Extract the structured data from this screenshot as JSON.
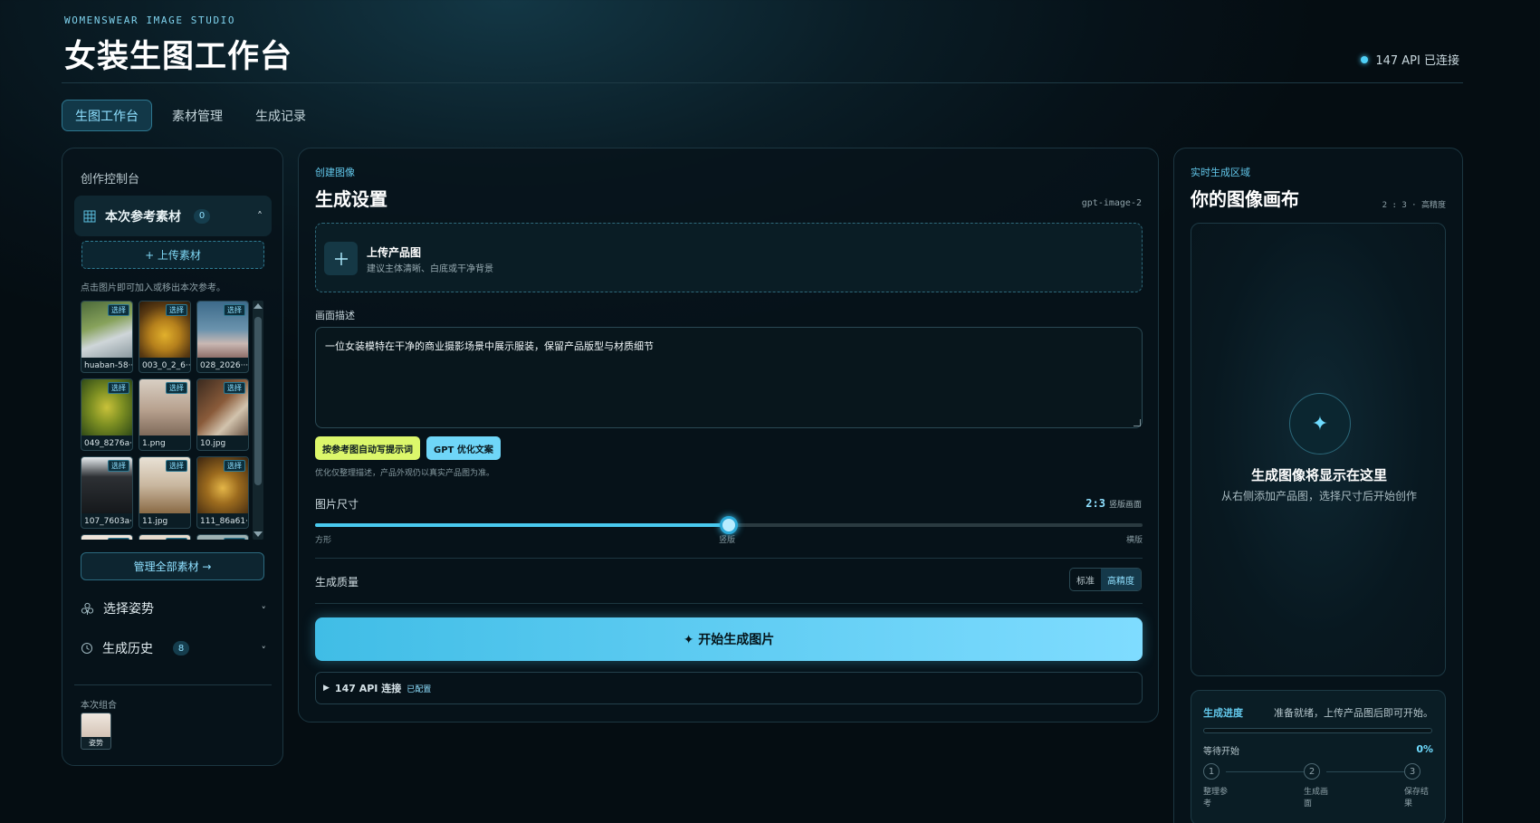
{
  "header": {
    "brand_sub": "WOMENSWEAR IMAGE STUDIO",
    "title": "女装生图工作台",
    "api_status": "147 API 已连接"
  },
  "colors": {
    "accent": "#4fd0f7",
    "lime": "#dcf76b",
    "bg": "#061219"
  },
  "tabs": [
    {
      "label": "生图工作台",
      "active": true
    },
    {
      "label": "素材管理",
      "active": false
    },
    {
      "label": "生成记录",
      "active": false
    }
  ],
  "left": {
    "title": "创作控制台",
    "ref_section": {
      "label": "本次参考素材",
      "count": "0",
      "caret": "˄",
      "icon": "grid-icon"
    },
    "upload_label": "+ 上传素材",
    "hint": "点击图片即可加入或移出本次参考。",
    "select_label": "选择",
    "thumbnails": [
      {
        "name": "huaban-58···"
      },
      {
        "name": "003_0_2_6···"
      },
      {
        "name": "028_2026···"
      },
      {
        "name": "049_8276a···"
      },
      {
        "name": "1.png"
      },
      {
        "name": "10.jpg"
      },
      {
        "name": "107_7603a···"
      },
      {
        "name": "11.jpg"
      },
      {
        "name": "111_86a61···"
      },
      {
        "name": ""
      },
      {
        "name": ""
      },
      {
        "name": ""
      }
    ],
    "manage_label": "管理全部素材 →",
    "pose": {
      "label": "选择姿势",
      "icon": "pose-icon",
      "chevron": "˅"
    },
    "history": {
      "label": "生成历史",
      "count": "8",
      "icon": "clock-icon",
      "chevron": "˅"
    },
    "combo_label": "本次组合",
    "combo_item": "姿势"
  },
  "mid": {
    "eyebrow": "创建图像",
    "title": "生成设置",
    "model": "gpt-image-2",
    "upload_title": "上传产品图",
    "upload_sub": "建议主体清晰、白底或干净背景",
    "upload_icon": "plus-icon",
    "desc_label": "画面描述",
    "prompt_value": "一位女装模特在干净的商业摄影场景中展示服装，保留产品版型与材质细节",
    "chip_auto": "按参考图自动写提示词",
    "chip_gpt": "GPT 优化文案",
    "opt_note": "优化仅整理描述，产品外观仍以真实产品图为准。",
    "size_label": "图片尺寸",
    "size_ratio": "2:3",
    "size_kind": "竖版画面",
    "slider_value": 0.5,
    "slider_ticks": [
      "方形",
      "竖版",
      "横版"
    ],
    "quality_label": "生成质量",
    "quality_options": [
      "标准",
      "高精度"
    ],
    "quality_selected": "高精度",
    "generate_label": "✦ 开始生成图片",
    "api_triangle": "▶",
    "api_label": "147 API 连接",
    "api_configured": "已配置"
  },
  "right": {
    "eyebrow": "实时生成区域",
    "title": "你的图像画布",
    "meta": "2 : 3 · 高精度",
    "spark": "✦",
    "canvas_title": "生成图像将显示在这里",
    "canvas_sub": "从右侧添加产品图，选择尺寸后开始创作",
    "progress": {
      "title": "生成进度",
      "status": "准备就绪，上传产品图后即可开始。",
      "value": 0,
      "waiting": "等待开始",
      "percent": "0%",
      "steps": [
        {
          "num": "1",
          "label": "整理参考"
        },
        {
          "num": "2",
          "label": "生成画面"
        },
        {
          "num": "3",
          "label": "保存结果"
        }
      ]
    }
  }
}
